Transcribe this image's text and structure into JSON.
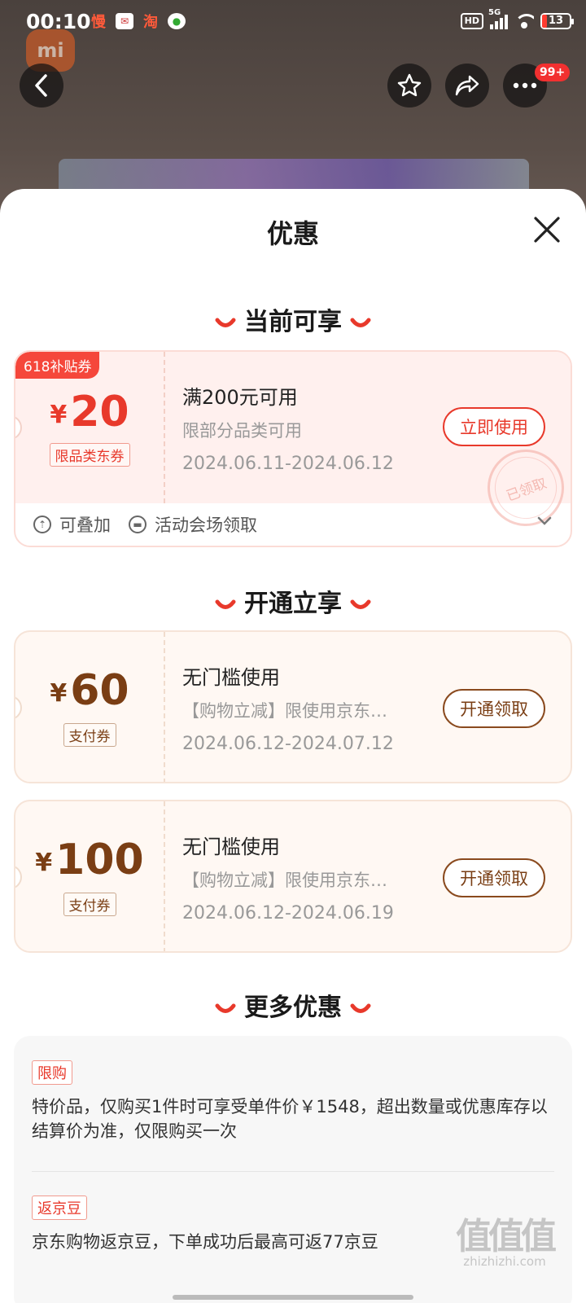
{
  "status_bar": {
    "time": "00:10",
    "left_icons": [
      "慢",
      "mail-icon",
      "淘",
      "wechat-icon"
    ],
    "hd": "HD",
    "network": "5G",
    "battery": "13"
  },
  "background": {
    "logo": "mi",
    "cart_badge": "99+"
  },
  "sheet": {
    "title": "优惠",
    "sections": {
      "current": "当前可享",
      "open": "开通立享",
      "more": "更多优惠"
    },
    "current_coupon": {
      "corner_badge": "618补贴券",
      "yen": "¥",
      "amount": "20",
      "tag": "限品类东券",
      "title": "满200元可用",
      "subtitle": "限部分品类可用",
      "date": "2024.06.11-2024.06.12",
      "button": "立即使用",
      "stamp": "已领取",
      "foot_stackable": "可叠加",
      "foot_source": "活动会场领取"
    },
    "open_coupons": [
      {
        "yen": "¥",
        "amount": "60",
        "tag": "支付券",
        "title": "无门槛使用",
        "subtitle": "【购物立减】限使用京东…",
        "date": "2024.06.12-2024.07.12",
        "button": "开通领取"
      },
      {
        "yen": "¥",
        "amount": "100",
        "tag": "支付券",
        "title": "无门槛使用",
        "subtitle": "【购物立减】限使用京东…",
        "date": "2024.06.12-2024.06.19",
        "button": "开通领取"
      }
    ],
    "more_offers": [
      {
        "tag": "限购",
        "text": "特价品，仅购买1件时可享受单件价￥1548，超出数量或优惠库存以结算价为准，仅限购买一次"
      },
      {
        "tag": "返京豆",
        "text": "京东购物返京豆，下单成功后最高可返77京豆"
      }
    ]
  },
  "watermark": {
    "main": "值值值",
    "sub": "zhizhizhi.com"
  },
  "colors": {
    "accent_red": "#e8392b",
    "brown": "#7a3e14",
    "pink_bg": "#fff0ee",
    "cream_bg": "#fff8f3"
  }
}
